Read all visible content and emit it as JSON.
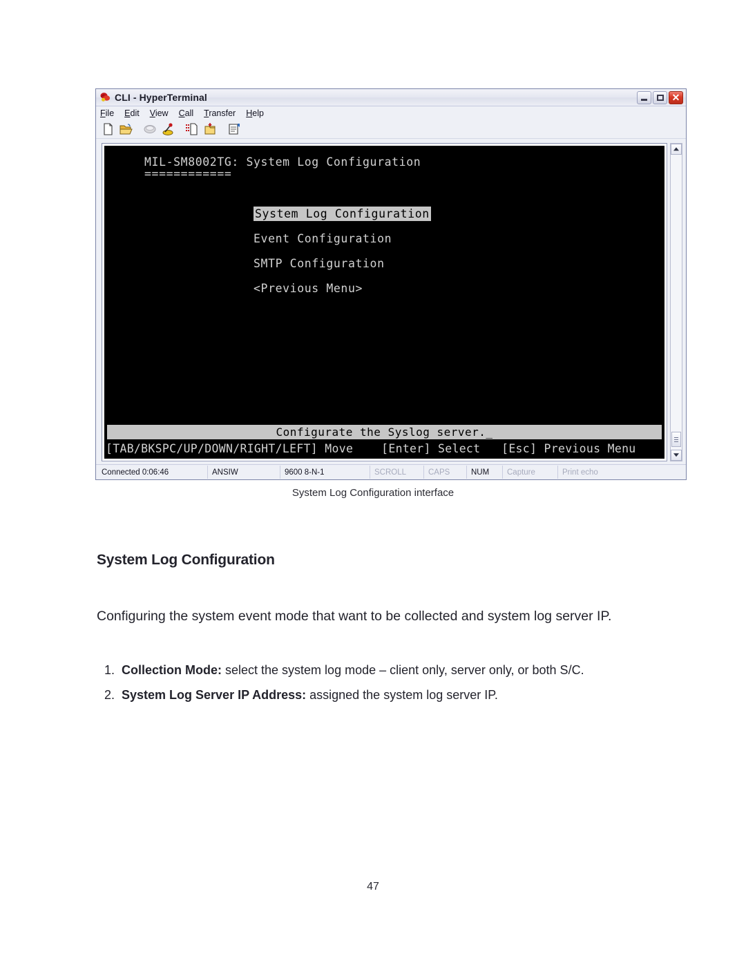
{
  "window": {
    "title": "CLI - HyperTerminal",
    "title_icon": "modem-phone-icon",
    "buttons": {
      "minimize": "Minimize",
      "maximize": "Maximize",
      "close": "Close"
    },
    "menu": [
      {
        "label": "File",
        "accel": "F",
        "rest": "ile"
      },
      {
        "label": "Edit",
        "accel": "E",
        "rest": "dit"
      },
      {
        "label": "View",
        "accel": "V",
        "rest": "iew"
      },
      {
        "label": "Call",
        "accel": "C",
        "rest": "all"
      },
      {
        "label": "Transfer",
        "accel": "T",
        "rest": "ransfer"
      },
      {
        "label": "Help",
        "accel": "H",
        "rest": "elp"
      }
    ],
    "toolbar": [
      {
        "name": "new-connection-icon",
        "title": "New"
      },
      {
        "name": "open-folder-icon",
        "title": "Open"
      },
      {
        "name": "call-icon",
        "title": "Call"
      },
      {
        "name": "disconnect-icon",
        "title": "Disconnect"
      },
      {
        "name": "send-file-icon",
        "title": "Send"
      },
      {
        "name": "receive-file-icon",
        "title": "Receive"
      },
      {
        "name": "properties-icon",
        "title": "Properties"
      }
    ],
    "statusbar": [
      {
        "text": "Connected 0:06:46",
        "dim": false
      },
      {
        "text": "ANSIW",
        "dim": false
      },
      {
        "text": "9600 8-N-1",
        "dim": false
      },
      {
        "text": "SCROLL",
        "dim": true
      },
      {
        "text": "CAPS",
        "dim": true
      },
      {
        "text": "NUM",
        "dim": false
      },
      {
        "text": "Capture",
        "dim": true
      },
      {
        "text": "Print echo",
        "dim": true
      }
    ]
  },
  "terminal": {
    "header": "MIL-SM8002TG: System Log Configuration",
    "rule": "============",
    "menu_items": [
      {
        "label": "System Log Configuration",
        "selected": true
      },
      {
        "label": "Event Configuration",
        "selected": false
      },
      {
        "label": "SMTP Configuration",
        "selected": false
      },
      {
        "label": "<Previous Menu>",
        "selected": false
      }
    ],
    "status_line": "Configurate the Syslog server._",
    "help_line": "[TAB/BKSPC/UP/DOWN/RIGHT/LEFT] Move    [Enter] Select   [Esc] Previous Menu",
    "colors": {
      "background": "#000000",
      "foreground": "#d2d2d2",
      "highlight_bg": "#c6c6c6",
      "highlight_fg": "#000000"
    }
  },
  "document": {
    "caption": "System Log Configuration interface",
    "heading": "System Log Configuration",
    "paragraph": "Configuring the system event mode that want to be collected and system log server IP.",
    "list": [
      {
        "num": "1.",
        "bold": "Collection Mode:",
        "rest": " select the system log mode – client only, server only, or both S/C."
      },
      {
        "num": "2.",
        "bold": "System Log Server IP Address:",
        "rest": " assigned the system log server IP."
      }
    ],
    "page_number": "47"
  }
}
